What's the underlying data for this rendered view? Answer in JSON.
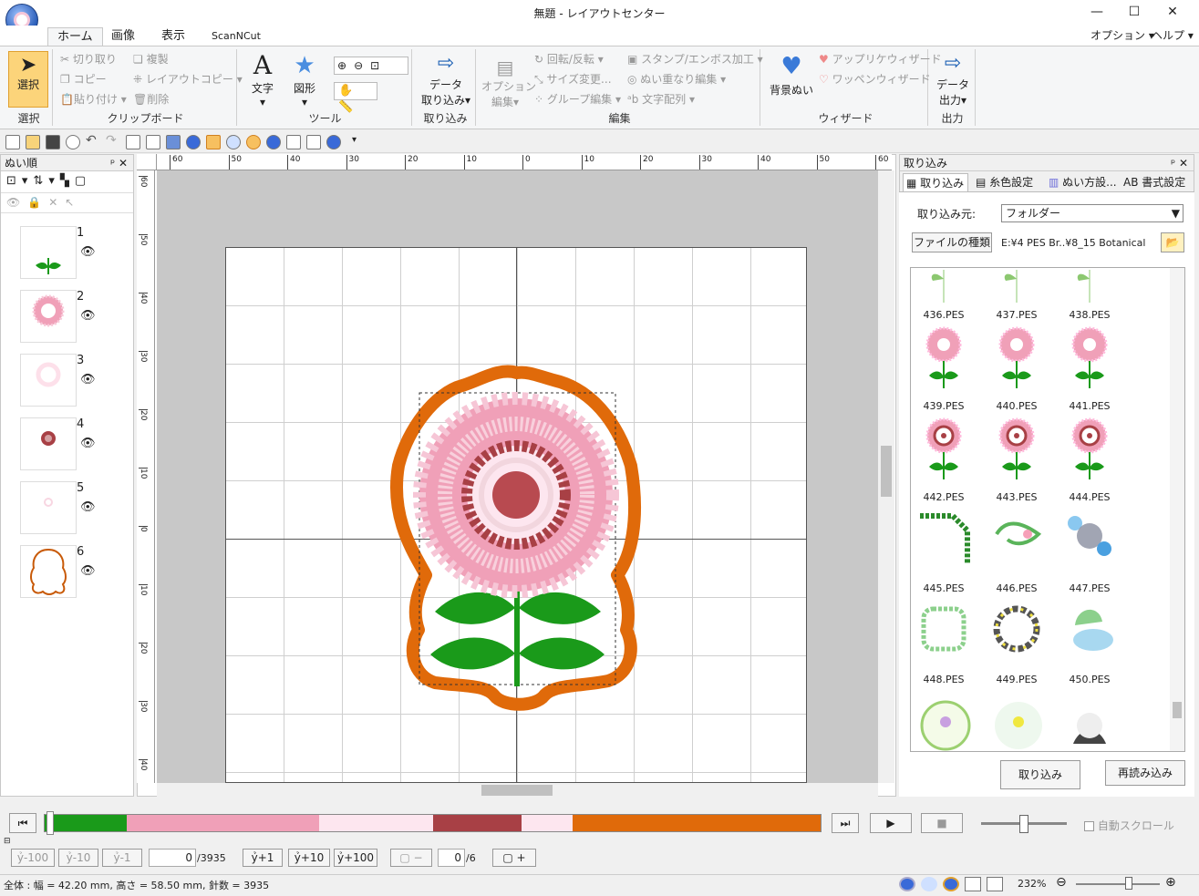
{
  "window": {
    "title": "無題 - レイアウトセンター",
    "minimize": "—",
    "maximize": "☐",
    "close": "✕"
  },
  "menu": {
    "tabs": [
      "ホーム",
      "画像",
      "表示",
      "ScanNCut"
    ],
    "options": "オプション",
    "help": "ヘルプ"
  },
  "ribbon": {
    "select": {
      "label": "選択",
      "group": "選択"
    },
    "clipboard": {
      "cut": "切り取り",
      "copy": "コピー",
      "paste": "貼り付け",
      "duplicate": "複製",
      "layout_copy": "レイアウトコピー",
      "delete": "削除",
      "group": "クリップボード"
    },
    "tools": {
      "text": "文字",
      "shape": "図形",
      "group": "ツール"
    },
    "import": {
      "label1": "データ",
      "label2": "取り込み",
      "group": "取り込み"
    },
    "edit": {
      "option_edit1": "オプション",
      "option_edit2": "編集",
      "rotate": "回転/反転",
      "size": "サイズ変更...",
      "group_edit": "グループ編集",
      "stamp": "スタンプ/エンボス加工",
      "overlap": "ぬい重なり編集",
      "text_arr": "文字配列",
      "group": "編集"
    },
    "wizard": {
      "bg": "背景ぬい",
      "applique": "アップリケウィザード",
      "patch": "ワッペンウィザード",
      "group": "ウィザード"
    },
    "output": {
      "label1": "データ",
      "label2": "出力",
      "group": "出力"
    }
  },
  "left_panel": {
    "title": "ぬい順",
    "layers": [
      {
        "num": "1"
      },
      {
        "num": "2"
      },
      {
        "num": "3"
      },
      {
        "num": "4"
      },
      {
        "num": "5"
      },
      {
        "num": "6"
      }
    ]
  },
  "ruler": {
    "h": [
      "60",
      "50",
      "40",
      "30",
      "20",
      "10",
      "0",
      "10",
      "20",
      "30",
      "40",
      "50",
      "60"
    ],
    "v": [
      "60",
      "50",
      "40",
      "30",
      "20",
      "10",
      "0",
      "10",
      "20",
      "30",
      "40"
    ]
  },
  "right_panel": {
    "title": "取り込み",
    "tabs": [
      "取り込み",
      "糸色設定",
      "ぬい方設...",
      "AB 書式設定"
    ],
    "source_label": "取り込み元:",
    "source_value": "フォルダー",
    "file_type_btn": "ファイルの種類",
    "path": "E:¥4 PES  Br..¥8_15 Botanical",
    "files": [
      "436.PES",
      "437.PES",
      "438.PES",
      "439.PES",
      "440.PES",
      "441.PES",
      "442.PES",
      "443.PES",
      "444.PES",
      "445.PES",
      "446.PES",
      "447.PES",
      "448.PES",
      "449.PES",
      "450.PES"
    ],
    "import_btn": "取り込み",
    "reload_btn": "再読み込み"
  },
  "colors": {
    "green": "#1a9a1a",
    "pink": "#f0a0b8",
    "lightpink": "#fde6ef",
    "maroon": "#a84045",
    "orange": "#e06a0a"
  },
  "playback": {
    "segments": [
      {
        "color": "#1a9a1a",
        "fraction": 0.106
      },
      {
        "color": "#f0a0b8",
        "fraction": 0.248
      },
      {
        "color": "#fde6ef",
        "fraction": 0.146
      },
      {
        "color": "#a84045",
        "fraction": 0.115
      },
      {
        "color": "#fde6ef",
        "fraction": 0.065
      },
      {
        "color": "#e06a0a",
        "fraction": 0.32
      }
    ],
    "auto_scroll": "自動スクロール"
  },
  "stepper": {
    "m100": "-100",
    "m10": "-10",
    "m1": "-1",
    "value": "0",
    "total": "/3935",
    "p1": "+1",
    "p10": "+10",
    "p100": "+100",
    "color_value": "0",
    "color_total": "/6",
    "minus": "−",
    "plus": "+"
  },
  "status": {
    "text": "全体 : 幅 = 42.20 mm, 高さ = 58.50 mm, 針数 = 3935",
    "zoom": "232%"
  }
}
